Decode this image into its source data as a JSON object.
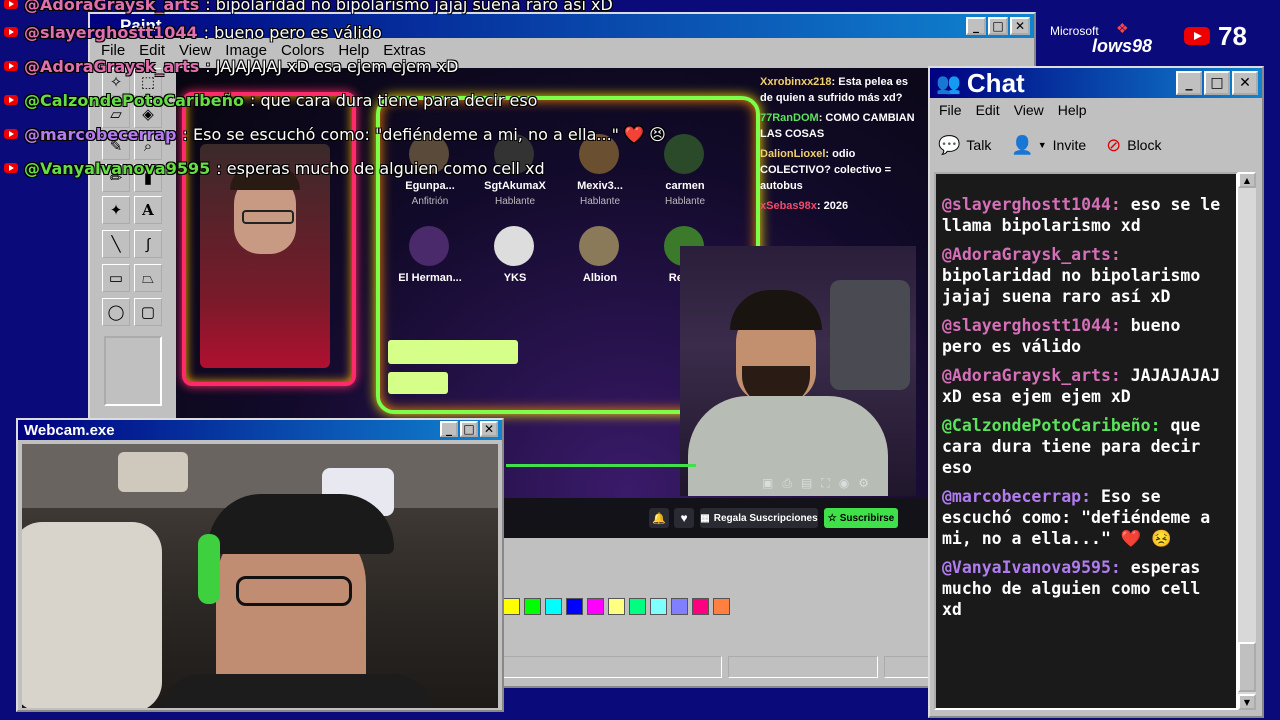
{
  "overlay_chat": [
    {
      "user": "@AdoraGraysk_arts",
      "message": ": bipolaridad no bipolarismo jajaj suena raro así xD",
      "color": "#e070b0"
    },
    {
      "user": "@slayerghostt1044",
      "message": ": bueno pero es válido",
      "color": "#e070b0"
    },
    {
      "user": "@AdoraGraysk_arts",
      "message": ": JAJAJAJAJ xD esa ejem ejem xD",
      "color": "#e070b0"
    },
    {
      "user": "@CalzondePotoCaribeño",
      "message": ": que cara dura tiene para decir eso",
      "color": "#66dd44"
    },
    {
      "user": "@marcobecerrap",
      "message": ": Eso se escuchó como: \"defiéndeme a mi, no a ella...\" ❤️ 😣",
      "color": "#b57cf0"
    },
    {
      "user": "@VanyaIvanova9595",
      "message": ": esperas mucho de alguien como cell xd",
      "color": "#66dd44"
    }
  ],
  "viewer_count": "78",
  "windows_logo": {
    "brand": "Microsoft",
    "product": "lows98"
  },
  "paint": {
    "title": "Paint",
    "menu": [
      "File",
      "Edit",
      "View",
      "Image",
      "Colors",
      "Help",
      "Extras"
    ],
    "palette": [
      "#ffff00",
      "#00ff00",
      "#00ffff",
      "#0000ff",
      "#ff00ff",
      "#ffff80",
      "#00ff80",
      "#80ffff",
      "#8080ff",
      "#ff0080",
      "#ff8040"
    ]
  },
  "stream": {
    "participants": [
      {
        "name": "Egunpa...",
        "role": "Anfitrión"
      },
      {
        "name": "SgtAkumaX",
        "role": "Hablante"
      },
      {
        "name": "Mexiv3...",
        "role": "Hablante"
      },
      {
        "name": "carmen",
        "role": "Hablante"
      },
      {
        "name": "El Herman...",
        "role": ""
      },
      {
        "name": "YKS",
        "role": ""
      },
      {
        "name": "Albion",
        "role": ""
      },
      {
        "name": "Rela...",
        "role": ""
      }
    ],
    "side_chat": [
      {
        "user": "Xxrobinxx218",
        "text": ": Esta pelea es de quien a sufrido más xd?"
      },
      {
        "user": "77RanDOM",
        "text": ": COMO CAMBIAN LAS COSAS"
      },
      {
        "user": "DalionLioxel",
        "text": ": odio COLECTIVO? colectivo = autobus"
      },
      {
        "user": "xSebas98x",
        "text": ": 2026"
      }
    ],
    "gift_button": "Regala Suscripciones",
    "subscribe_button": "Suscribirse"
  },
  "webcam": {
    "title": "Webcam.exe"
  },
  "chat_window": {
    "title": "Chat",
    "menu": [
      "File",
      "Edit",
      "View",
      "Help"
    ],
    "toolbar": [
      "Talk",
      "Invite",
      "Block"
    ],
    "messages": [
      {
        "user": "@slayerghostt1044:",
        "text": "eso se le llama bipolarismo xd",
        "color_class": "u-pink"
      },
      {
        "user": "@AdoraGraysk_arts:",
        "text": "bipolaridad no bipolarismo jajaj suena raro así xD",
        "color_class": "u-pink"
      },
      {
        "user": "@slayerghostt1044:",
        "text": "bueno pero es válido",
        "color_class": "u-pink"
      },
      {
        "user": "@AdoraGraysk_arts:",
        "text": "JAJAJAJAJ xD esa ejem ejem xD",
        "color_class": "u-pink"
      },
      {
        "user": "@CalzondePotoCaribeño:",
        "text": "que cara dura tiene para decir eso",
        "color_class": "u-green"
      },
      {
        "user": "@marcobecerrap:",
        "text": "Eso se escuchó como: \"defiéndeme a mi, no a ella...\" ❤️ 😣",
        "color_class": "u-purple"
      },
      {
        "user": "@VanyaIvanova9595:",
        "text": "esperas mucho de alguien como cell xd",
        "color_class": "u-purple"
      }
    ]
  }
}
